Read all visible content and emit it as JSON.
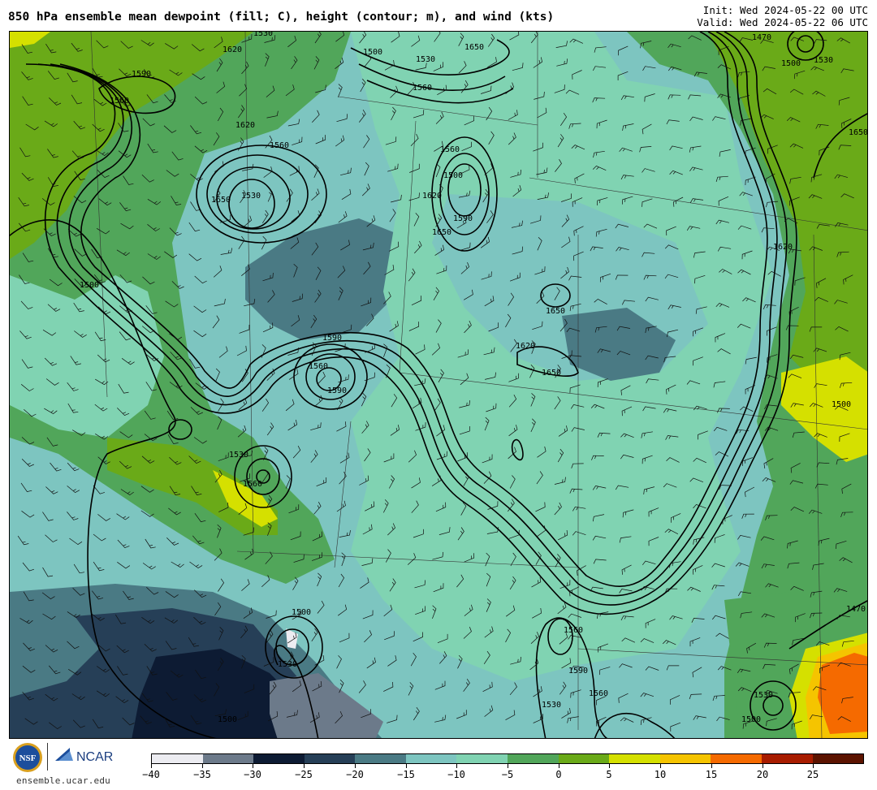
{
  "header": {
    "title": "850 hPa ensemble mean dewpoint (fill; C), height (contour; m), and wind (kts)",
    "init": "Init: Wed 2024-05-22 00 UTC",
    "valid": "Valid: Wed 2024-05-22 06 UTC"
  },
  "footer": {
    "site": "ensemble.ucar.edu",
    "nsf_text": "NSF",
    "ncar_text": "NCAR"
  },
  "colorbar": {
    "colors": [
      "#ececf1",
      "#6c7a8a",
      "#0d1b33",
      "#263f57",
      "#4a7a84",
      "#7dc5c0",
      "#80d3b2",
      "#51a65a",
      "#6aaa18",
      "#d5e000",
      "#f5c400",
      "#f56a00",
      "#a81c00",
      "#5c1300"
    ],
    "tick_labels": [
      "−40",
      "−35",
      "−30",
      "−25",
      "−20",
      "−15",
      "−10",
      "−5",
      "0",
      "5",
      "10",
      "15",
      "20",
      "25"
    ]
  },
  "map_labels": {
    "contours": [
      "1530",
      "1620",
      "1590",
      "1560",
      "1500",
      "1650",
      "1530",
      "1560",
      "1470",
      "1500",
      "1530",
      "1560",
      "1620",
      "1650",
      "1530",
      "1500",
      "1560",
      "1590",
      "1620",
      "1650",
      "1590",
      "1560",
      "1590",
      "1620",
      "1650",
      "1650",
      "1500",
      "1530",
      "1560",
      "1500",
      "1530",
      "1560",
      "1590",
      "1500",
      "1530",
      "1560",
      "1620",
      "1650",
      "1530",
      "1500",
      "1470",
      "1470",
      "1500"
    ]
  }
}
